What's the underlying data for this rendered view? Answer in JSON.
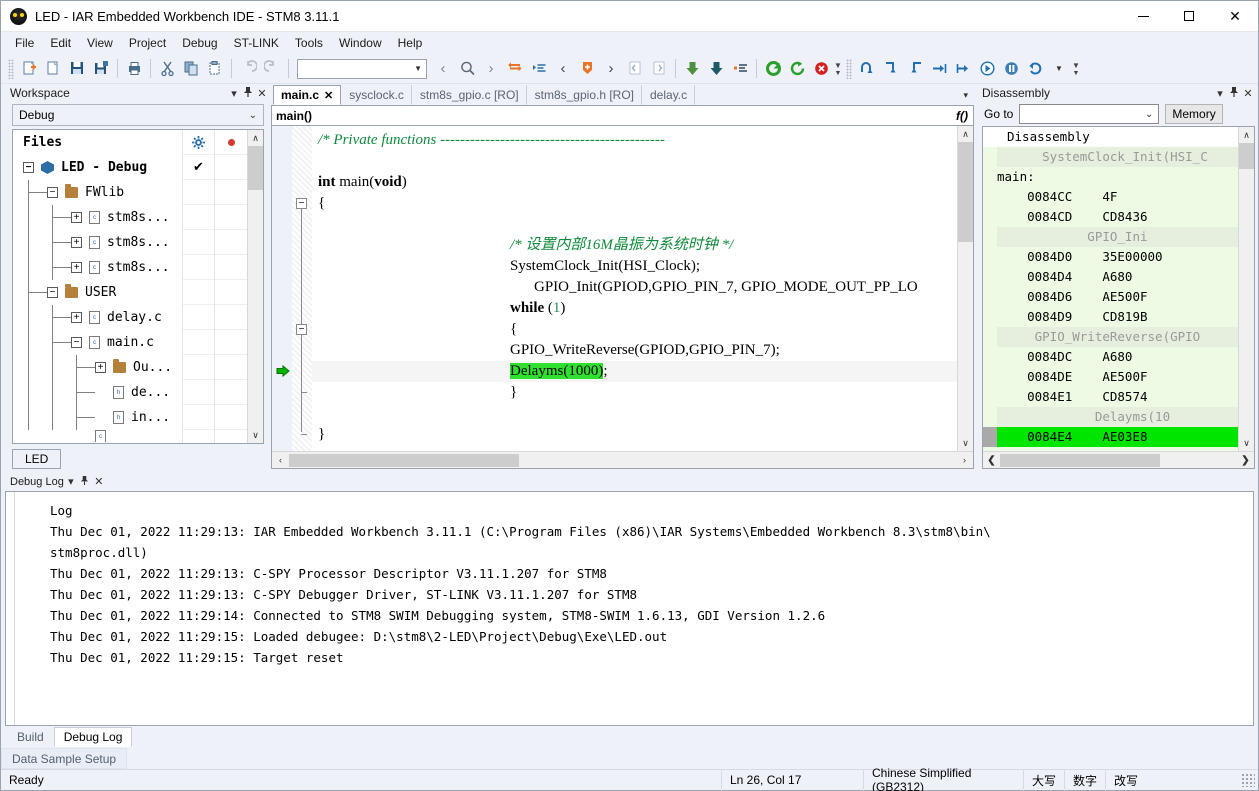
{
  "window": {
    "title": "LED - IAR Embedded Workbench IDE - STM8 3.11.1",
    "app_icon": "iar-logo-icon",
    "minimize": "—",
    "maximize": "□",
    "close": "✕"
  },
  "menubar": {
    "items": [
      "File",
      "Edit",
      "View",
      "Project",
      "Debug",
      "ST-LINK",
      "Tools",
      "Window",
      "Help"
    ]
  },
  "toolbar": {
    "combo_value": "",
    "buttons": [
      {
        "name": "new-document-icon",
        "glyph": "➕"
      },
      {
        "name": "open-file-icon",
        "glyph": "🗋"
      },
      {
        "name": "save-icon",
        "glyph": "💾"
      },
      {
        "name": "save-all-icon",
        "glyph": "🖫"
      },
      {
        "name": "print-icon",
        "glyph": "🖨"
      },
      {
        "name": "cut-icon",
        "glyph": "✂"
      },
      {
        "name": "copy-icon",
        "glyph": "⧉"
      },
      {
        "name": "paste-icon",
        "glyph": "📋"
      },
      {
        "name": "undo-icon",
        "glyph": "↶"
      },
      {
        "name": "redo-icon",
        "glyph": "↷"
      },
      {
        "name": "navigate-back-icon",
        "glyph": "‹"
      },
      {
        "name": "find-icon",
        "glyph": "🔍"
      },
      {
        "name": "navigate-forward-icon",
        "glyph": "›"
      },
      {
        "name": "go-to-icon",
        "glyph": "⇆"
      },
      {
        "name": "toggle-bookmark-icon",
        "glyph": "▶≡"
      },
      {
        "name": "previous-bookmark-icon",
        "glyph": "‹"
      },
      {
        "name": "bookmark-icon",
        "glyph": "⮟"
      },
      {
        "name": "next-bookmark-icon",
        "glyph": "›"
      },
      {
        "name": "indent-left-icon",
        "glyph": "‹|"
      },
      {
        "name": "indent-right-icon",
        "glyph": "|›"
      },
      {
        "name": "compile-icon",
        "glyph": "⬇"
      },
      {
        "name": "make-icon",
        "glyph": "⬇"
      },
      {
        "name": "build-all-icon",
        "glyph": "▪≡"
      },
      {
        "name": "download-and-debug-icon",
        "glyph": "↻"
      },
      {
        "name": "debug-without-download-icon",
        "glyph": "↺"
      },
      {
        "name": "stop-debugging-icon",
        "glyph": "✖"
      },
      {
        "name": "step-over-icon",
        "glyph": "⤷"
      },
      {
        "name": "step-into-icon",
        "glyph": "↘"
      },
      {
        "name": "step-out-icon",
        "glyph": "↗"
      },
      {
        "name": "next-statement-icon",
        "glyph": "⇥"
      },
      {
        "name": "run-to-cursor-icon",
        "glyph": "⇥|"
      },
      {
        "name": "go-icon",
        "glyph": "▶"
      },
      {
        "name": "break-icon",
        "glyph": "⏸"
      },
      {
        "name": "reset-icon",
        "glyph": "↺"
      },
      {
        "name": "dropdown-more-icon",
        "glyph": "▾"
      }
    ]
  },
  "workspace": {
    "title": "Workspace",
    "dropdown_icon": "▾",
    "pin_icon": "📌",
    "close_icon": "✕",
    "config": "Debug",
    "config_chevron": "⌄",
    "col_files": "Files",
    "col_gear_icon": "gear-icon",
    "col_dot_icon": "red-dot-icon",
    "tree": [
      {
        "label": "LED - Debug",
        "indent": 0,
        "expander": "−",
        "icon": "project",
        "bold": true,
        "check": "✔"
      },
      {
        "label": "FWlib",
        "indent": 1,
        "expander": "−",
        "icon": "folder",
        "bold": false,
        "check": ""
      },
      {
        "label": "stm8s...",
        "indent": 2,
        "expander": "+",
        "icon": "file-c",
        "bold": false,
        "check": ""
      },
      {
        "label": "stm8s...",
        "indent": 2,
        "expander": "+",
        "icon": "file-c",
        "bold": false,
        "check": ""
      },
      {
        "label": "stm8s...",
        "indent": 2,
        "expander": "+",
        "icon": "file-c",
        "bold": false,
        "check": ""
      },
      {
        "label": "USER",
        "indent": 1,
        "expander": "−",
        "icon": "folder",
        "bold": false,
        "check": ""
      },
      {
        "label": "delay.c",
        "indent": 2,
        "expander": "+",
        "icon": "file-c",
        "bold": false,
        "check": ""
      },
      {
        "label": "main.c",
        "indent": 2,
        "expander": "−",
        "icon": "file-c",
        "bold": false,
        "check": ""
      },
      {
        "label": "Ou...",
        "indent": 3,
        "expander": "+",
        "icon": "folder",
        "bold": false,
        "check": ""
      },
      {
        "label": "de...",
        "indent": 3,
        "expander": "",
        "icon": "file-h",
        "bold": false,
        "check": ""
      },
      {
        "label": "in...",
        "indent": 3,
        "expander": "",
        "icon": "file-h",
        "bold": false,
        "check": ""
      }
    ],
    "tab": "LED",
    "scroll_up": "∧",
    "scroll_down": "∨"
  },
  "editor": {
    "tabs": [
      {
        "label": "main.c",
        "active": true,
        "close": "✕"
      },
      {
        "label": "sysclock.c",
        "active": false,
        "close": ""
      },
      {
        "label": "stm8s_gpio.c [RO]",
        "active": false,
        "close": ""
      },
      {
        "label": "stm8s_gpio.h [RO]",
        "active": false,
        "close": ""
      },
      {
        "label": "delay.c",
        "active": false,
        "close": ""
      }
    ],
    "tabs_overflow_icon": "▾",
    "function_bar": "main()",
    "function_icon": "f()",
    "pc_arrow_icon": "execution-pointer-icon",
    "lines": [
      {
        "indent": 0,
        "tokens": [
          {
            "t": "comment",
            "v": "/* Private functions ---------------------------------------------"
          }
        ],
        "current": false
      },
      {
        "indent": 0,
        "tokens": [],
        "current": false
      },
      {
        "indent": 0,
        "tokens": [
          {
            "t": "kw",
            "v": "int"
          },
          {
            "t": "plain",
            "v": " main("
          },
          {
            "t": "kw",
            "v": "void"
          },
          {
            "t": "plain",
            "v": ")"
          }
        ],
        "current": false
      },
      {
        "indent": 0,
        "tokens": [
          {
            "t": "plain",
            "v": "{"
          }
        ],
        "current": false
      },
      {
        "indent": 0,
        "tokens": [],
        "current": false
      },
      {
        "indent": 8,
        "tokens": [
          {
            "t": "comment",
            "v": "/* 设置内部16M晶振为系统时钟 */"
          }
        ],
        "current": false
      },
      {
        "indent": 8,
        "tokens": [
          {
            "t": "plain",
            "v": "SystemClock_Init(HSI_Clock);"
          }
        ],
        "current": false
      },
      {
        "indent": 9,
        "tokens": [
          {
            "t": "plain",
            "v": "GPIO_Init(GPIOD,GPIO_PIN_7, GPIO_MODE_OUT_PP_LO"
          }
        ],
        "current": false
      },
      {
        "indent": 8,
        "tokens": [
          {
            "t": "kw",
            "v": "while"
          },
          {
            "t": "plain",
            "v": " "
          },
          {
            "t": "plain",
            "v": "("
          },
          {
            "t": "num",
            "v": "1"
          },
          {
            "t": "plain",
            "v": ")"
          }
        ],
        "current": false
      },
      {
        "indent": 8,
        "tokens": [
          {
            "t": "plain",
            "v": "{"
          }
        ],
        "current": false
      },
      {
        "indent": 8,
        "tokens": [
          {
            "t": "plain",
            "v": "GPIO_WriteReverse(GPIOD,GPIO_PIN_7);"
          }
        ],
        "current": false
      },
      {
        "indent": 8,
        "tokens": [
          {
            "t": "sel",
            "v": "Delayms(1000)"
          },
          {
            "t": "plain",
            "v": ";"
          }
        ],
        "current": true
      },
      {
        "indent": 8,
        "tokens": [
          {
            "t": "plain",
            "v": "}"
          }
        ],
        "current": false
      },
      {
        "indent": 0,
        "tokens": [],
        "current": false
      },
      {
        "indent": 0,
        "tokens": [
          {
            "t": "plain",
            "v": "}"
          }
        ],
        "current": false
      }
    ],
    "hscroll_left": "‹",
    "hscroll_right": "›",
    "vscroll_up": "∧",
    "vscroll_down": "∨"
  },
  "disassembly": {
    "title": "Disassembly",
    "dropdown_icon": "▾",
    "pin_icon": "📌",
    "close_icon": "✕",
    "goto_label": "Go to",
    "goto_value": "",
    "goto_chevron": "⌄",
    "memory_button": "Memory",
    "rows": [
      {
        "kind": "title",
        "text": "Disassembly"
      },
      {
        "kind": "src",
        "text": "      SystemClock_Init(HSI_C"
      },
      {
        "kind": "code",
        "text": "main:"
      },
      {
        "kind": "code",
        "text": "    0084CC    4F"
      },
      {
        "kind": "code",
        "text": "    0084CD    CD8436"
      },
      {
        "kind": "src",
        "text": "            GPIO_Ini"
      },
      {
        "kind": "code",
        "text": "    0084D0    35E00000"
      },
      {
        "kind": "code",
        "text": "    0084D4    A680"
      },
      {
        "kind": "code",
        "text": "    0084D6    AE500F"
      },
      {
        "kind": "code",
        "text": "    0084D9    CD819B"
      },
      {
        "kind": "src",
        "text": "     GPIO_WriteReverse(GPIO"
      },
      {
        "kind": "code",
        "text": "    0084DC    A680"
      },
      {
        "kind": "code",
        "text": "    0084DE    AE500F"
      },
      {
        "kind": "code",
        "text": "    0084E1    CD8574"
      },
      {
        "kind": "src",
        "text": "             Delayms(10"
      },
      {
        "kind": "pc",
        "text": "    0084E4    AE03E8"
      }
    ],
    "scroll_up": "∧",
    "scroll_down": "∨",
    "hscroll_left": "❮",
    "hscroll_right": "❯"
  },
  "debuglog": {
    "title": "Debug Log",
    "dropdown_icon": "▾",
    "pin_icon": "📌",
    "close_icon": "✕",
    "header": "Log",
    "lines": [
      "Thu Dec 01, 2022 11:29:13: IAR Embedded Workbench 3.11.1 (C:\\Program Files (x86)\\IAR Systems\\Embedded Workbench 8.3\\stm8\\bin\\",
      "stm8proc.dll)",
      "Thu Dec 01, 2022 11:29:13: C-SPY Processor Descriptor V3.11.1.207 for STM8",
      "Thu Dec 01, 2022 11:29:13: C-SPY Debugger Driver, ST-LINK V3.11.1.207 for STM8",
      "Thu Dec 01, 2022 11:29:14: Connected to STM8 SWIM Debugging system, STM8-SWIM 1.6.13, GDI Version 1.2.6",
      "Thu Dec 01, 2022 11:29:15: Loaded debugee: D:\\stm8\\2-LED\\Project\\Debug\\Exe\\LED.out",
      "Thu Dec 01, 2022 11:29:15: Target reset"
    ]
  },
  "bottom_tabs": [
    {
      "label": "Build",
      "active": false
    },
    {
      "label": "Debug Log",
      "active": true
    }
  ],
  "sample_tabs": [
    {
      "label": "Data Sample Setup"
    }
  ],
  "statusbar": {
    "ready": "Ready",
    "position": "Ln 26, Col 17",
    "language": "Chinese Simplified (GB2312)",
    "caps": "大写",
    "num": "数字",
    "ovr": "改写"
  },
  "colors": {
    "accent_blue": "#2e6ea6",
    "comment_green": "#0f8a3c",
    "selection_green": "#2fe02f",
    "pc_green": "#00e500",
    "panel_bg": "#eef1f8",
    "disasm_bg": "#eefbe4"
  }
}
